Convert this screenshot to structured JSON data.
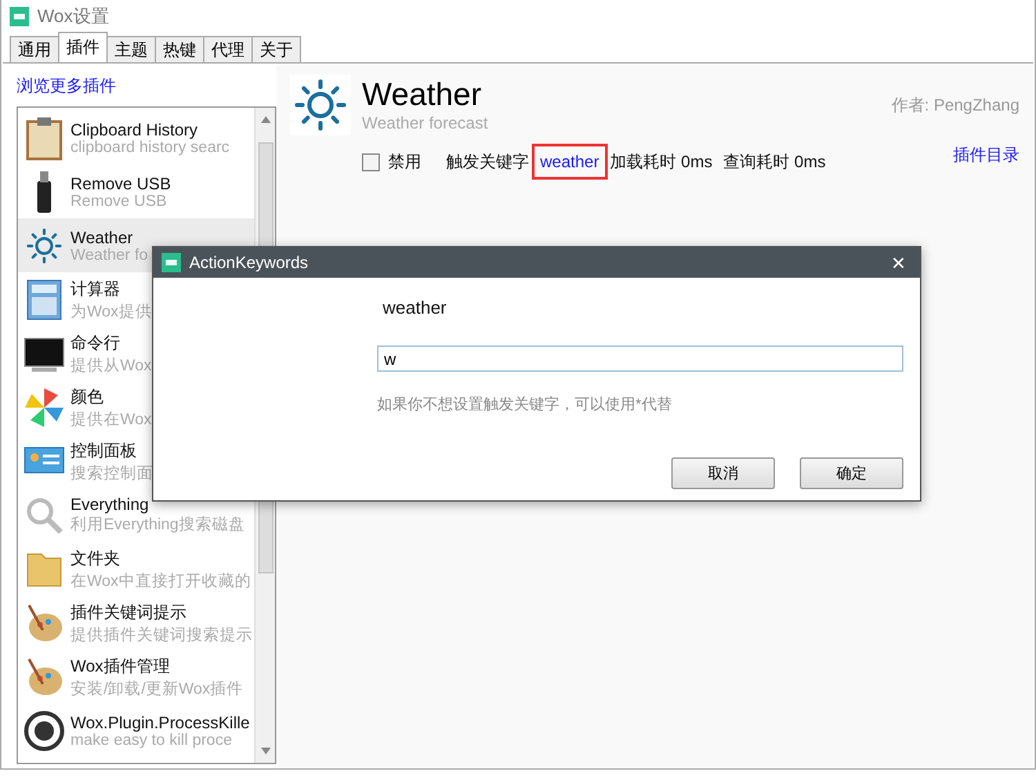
{
  "window": {
    "title": "Wox设置"
  },
  "tabs": [
    {
      "label": "通用",
      "selected": false
    },
    {
      "label": "插件",
      "selected": true
    },
    {
      "label": "主题",
      "selected": false
    },
    {
      "label": "热键",
      "selected": false
    },
    {
      "label": "代理",
      "selected": false
    },
    {
      "label": "关于",
      "selected": false
    }
  ],
  "browse_link": "浏览更多插件",
  "plugins": [
    {
      "name": "Clipboard History",
      "description": "clipboard history searc",
      "selected": false
    },
    {
      "name": "Remove USB",
      "description": "Remove USB",
      "selected": false
    },
    {
      "name": "Weather",
      "description": "Weather fo",
      "selected": true
    },
    {
      "name": "计算器",
      "description": "为Wox提供",
      "selected": false
    },
    {
      "name": "命令行",
      "description": "提供从Wox",
      "selected": false
    },
    {
      "name": "颜色",
      "description": "提供在Wox",
      "selected": false
    },
    {
      "name": "控制面板",
      "description": "搜索控制面",
      "selected": false
    },
    {
      "name": "Everything",
      "description": "利用Everything搜索磁盘",
      "selected": false
    },
    {
      "name": "文件夹",
      "description": "在Wox中直接打开收藏的",
      "selected": false
    },
    {
      "name": "插件关键词提示",
      "description": "提供插件关键词搜索提示",
      "selected": false
    },
    {
      "name": "Wox插件管理",
      "description": "安装/卸载/更新Wox插件",
      "selected": false
    },
    {
      "name": "Wox.Plugin.ProcessKille",
      "description": "make easy to kill proce",
      "selected": false
    }
  ],
  "detail": {
    "name": "Weather",
    "description": "Weather forecast",
    "author": "作者: PengZhang",
    "disable": {
      "label": "禁用",
      "checked": false
    },
    "keyword_label": "触发关键字",
    "keyword": "weather",
    "keyword_highlighted": true,
    "load_time": "加载耗时 0ms",
    "query_time": "查询耗时 0ms",
    "directory_link": "插件目录"
  },
  "dialog": {
    "title": "ActionKeywords",
    "close": "✕",
    "current_keyword": "weather",
    "input_value": "w",
    "hint": "如果你不想设置触发关键字，可以使用*代替",
    "buttons": [
      "取消",
      "确定"
    ]
  }
}
